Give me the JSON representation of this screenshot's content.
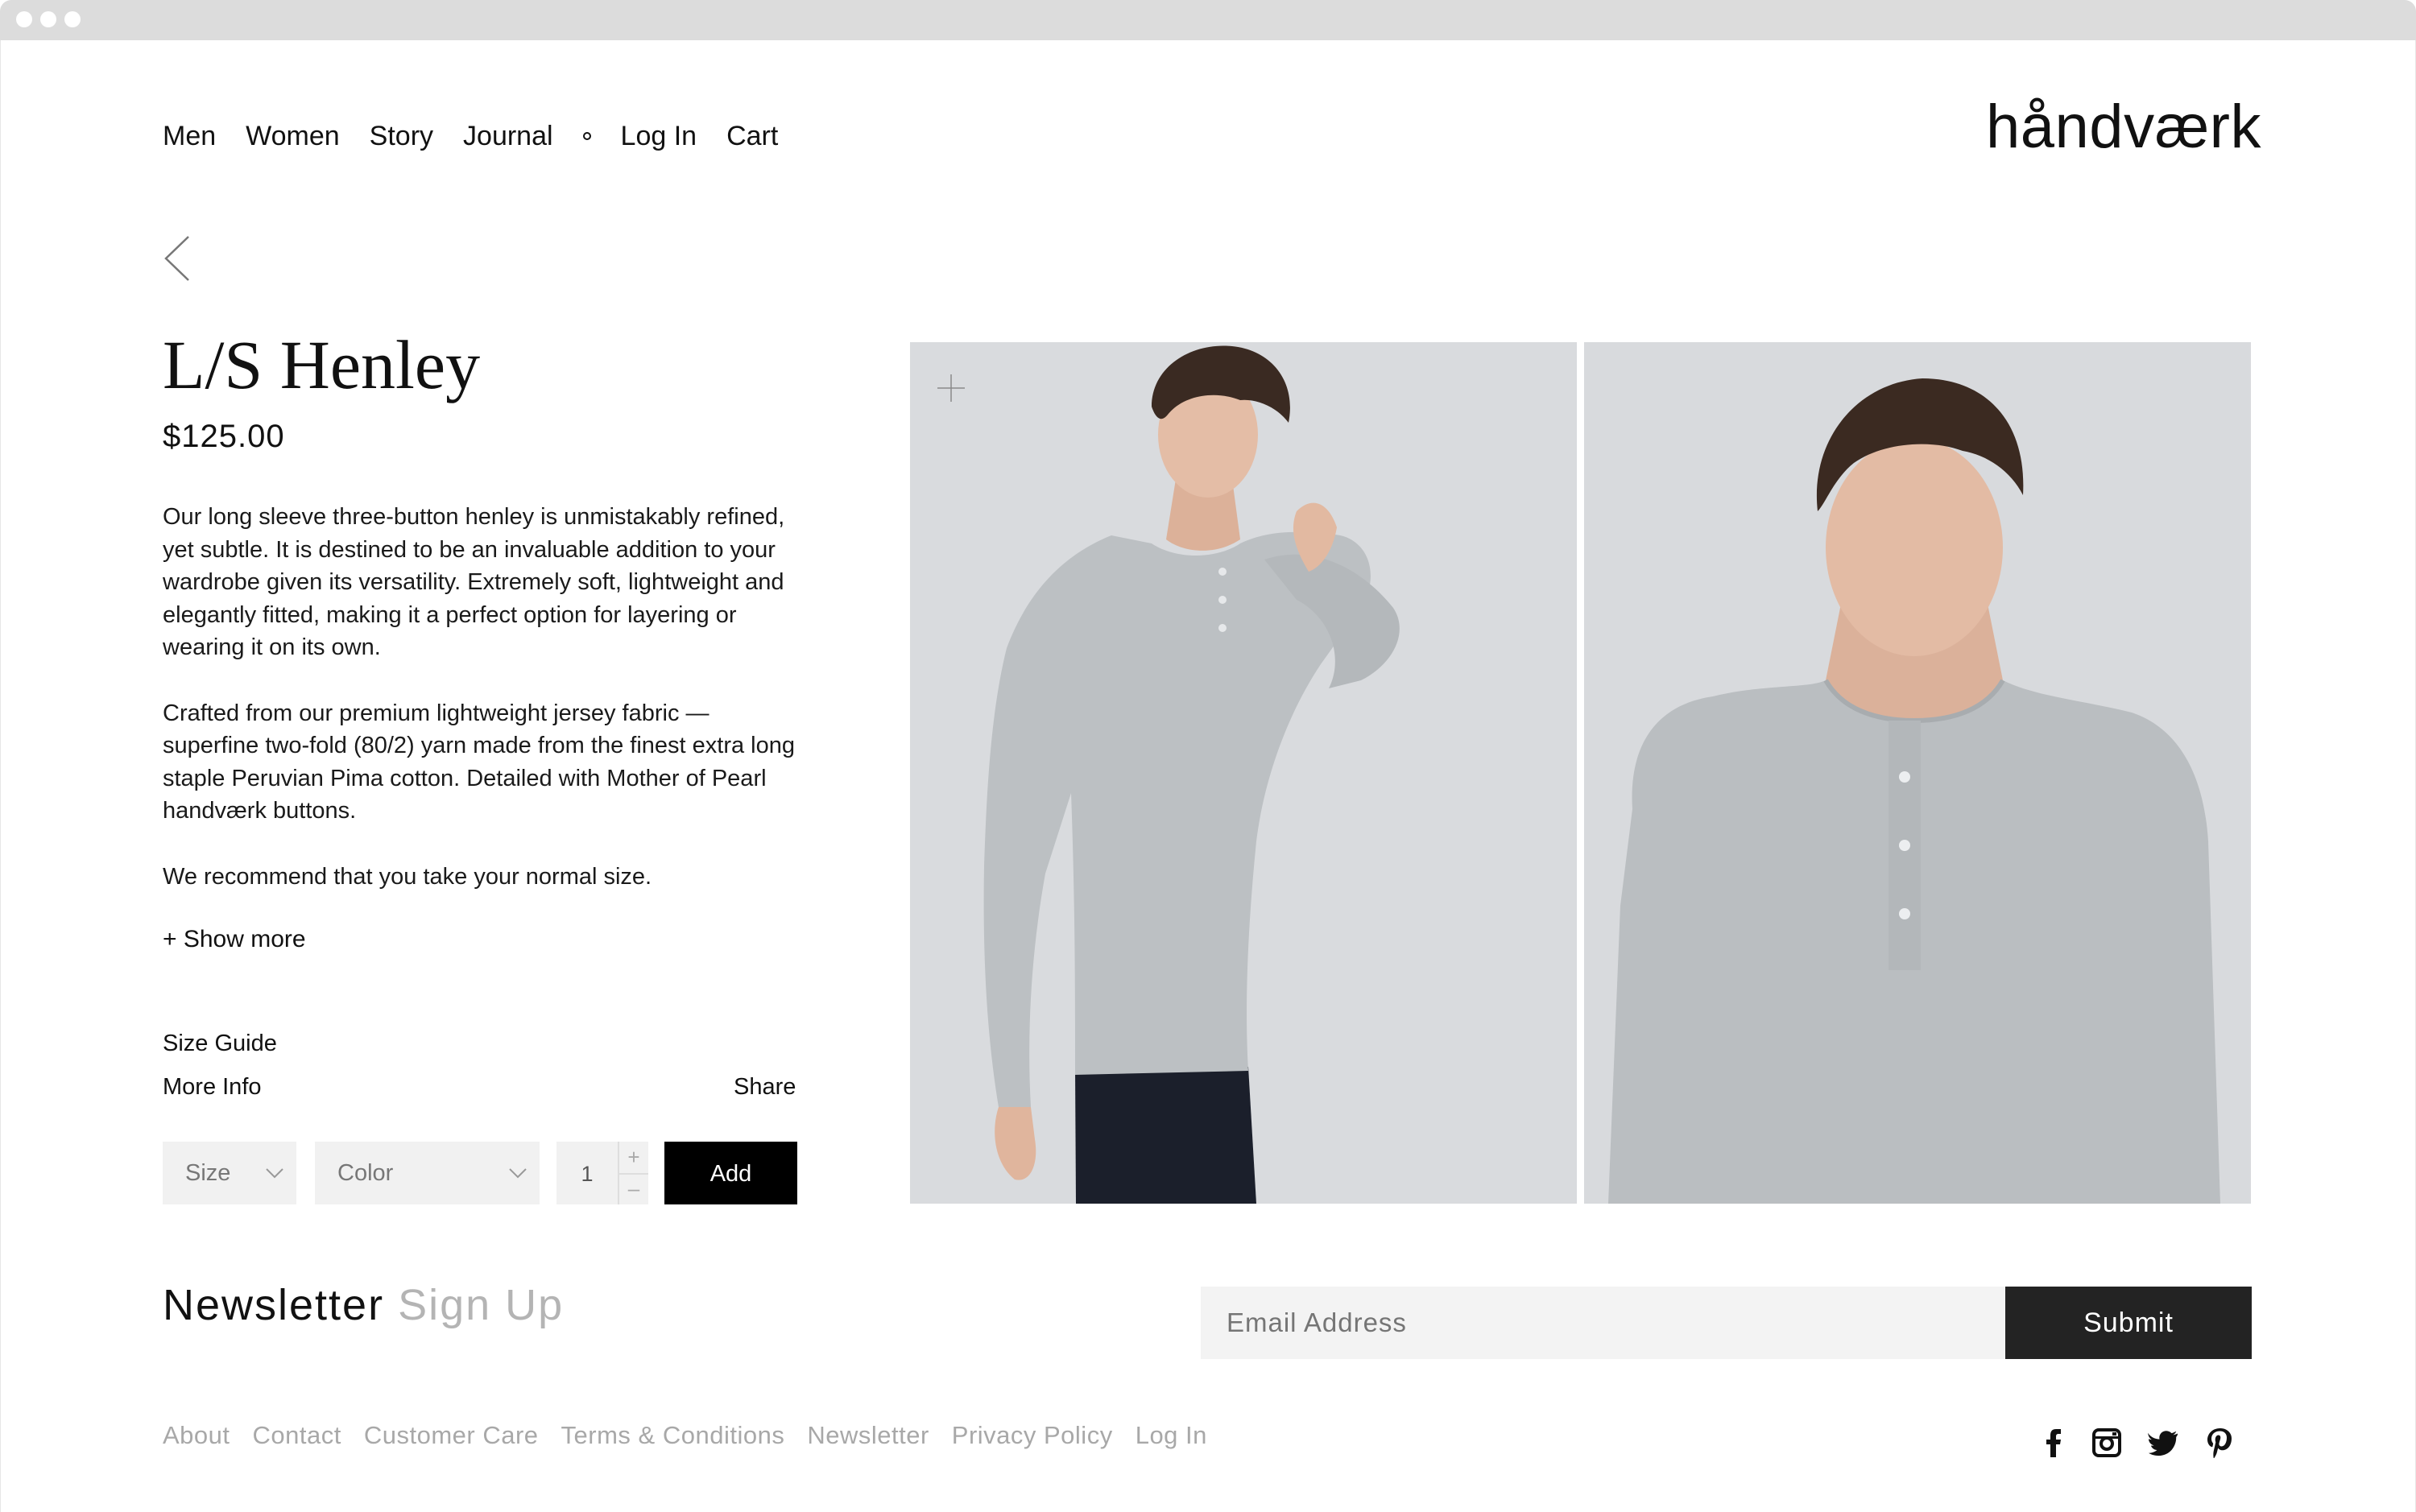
{
  "nav": {
    "items": [
      "Men",
      "Women",
      "Story",
      "Journal"
    ],
    "account": [
      "Log In",
      "Cart"
    ]
  },
  "brand": {
    "logo": "håndværk"
  },
  "product": {
    "title": "L/S Henley",
    "price": "$125.00",
    "description": [
      "Our long sleeve three-button henley is unmistakably refined, yet subtle. It is destined to be an invaluable addition to your wardrobe given its versatility. Extremely soft, lightweight and elegantly fitted, making it a perfect option for layering or wearing it on its own.",
      "Crafted from our premium lightweight jersey fabric — superfine two-fold (80/2) yarn made from the finest extra long staple Peruvian Pima cotton. Detailed with Mother of Pearl handværk buttons.",
      "We recommend that you take your normal size."
    ],
    "show_more": "+ Show more",
    "size_guide": "Size Guide",
    "more_info": "More Info",
    "share": "Share",
    "size_select": "Size",
    "color_select": "Color",
    "quantity": "1",
    "qty_plus": "+",
    "qty_minus": "–",
    "add_label": "Add"
  },
  "newsletter": {
    "title_dark": "Newsletter",
    "title_light": "Sign Up",
    "email_placeholder": "Email Address",
    "submit_label": "Submit"
  },
  "footer": {
    "links": [
      "About",
      "Contact",
      "Customer Care",
      "Terms & Conditions",
      "Newsletter",
      "Privacy Policy",
      "Log In"
    ]
  },
  "social": [
    "facebook-icon",
    "instagram-icon",
    "twitter-icon",
    "pinterest-icon"
  ],
  "colors": {
    "background": "#ffffff",
    "text": "#111111",
    "muted": "#a8a8a8",
    "button_dark": "#000000",
    "input_bg": "#f1f1f1",
    "photo_bg": "#d8dadd",
    "shirt_gray": "#b9bdc0"
  }
}
